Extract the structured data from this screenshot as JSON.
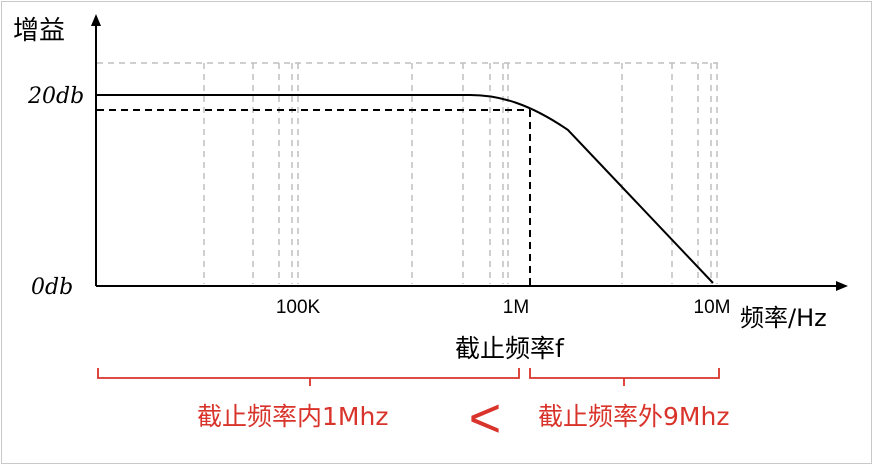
{
  "axis": {
    "y_label": "增益",
    "y_ticks": [
      "20db",
      "0db"
    ],
    "x_ticks": [
      "100K",
      "1M",
      "10M"
    ],
    "x_label": "频率/Hz"
  },
  "cutoff_label": "截止频率f",
  "bottom": {
    "left_text": "截止频率内1Mhz",
    "comparator": "<",
    "right_text": "截止频率外9Mhz"
  },
  "colors": {
    "curve": "#000000",
    "grid": "#bfbfbf",
    "brace": "#d9342b",
    "text_red": "#d9342b"
  }
}
